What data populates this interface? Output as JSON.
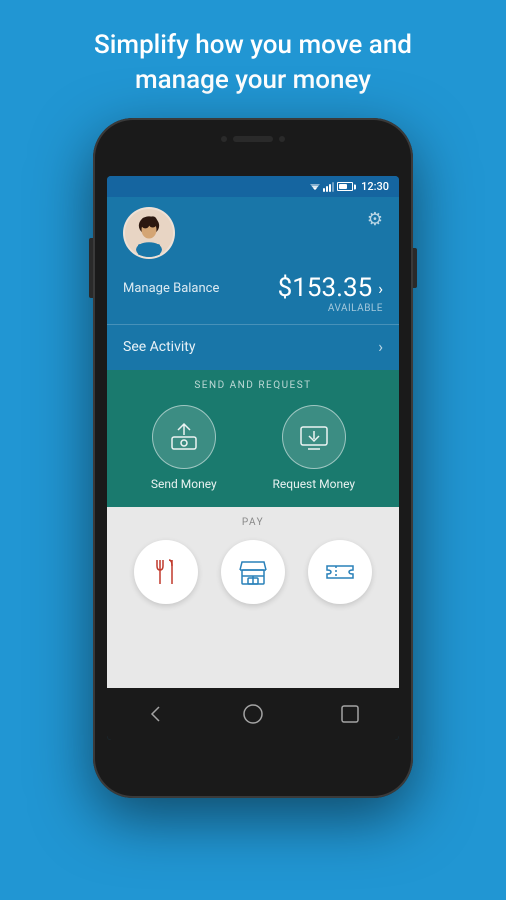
{
  "headline": {
    "line1": "Simplify how you move and",
    "line2": "manage your money"
  },
  "status_bar": {
    "time": "12:30"
  },
  "profile": {
    "manage_balance_label": "Manage Balance",
    "balance": "$153.35",
    "available_label": "AVAILABLE",
    "see_activity_label": "See Activity"
  },
  "send_request": {
    "section_title": "SEND AND REQUEST",
    "send_label": "Send Money",
    "request_label": "Request Money"
  },
  "pay": {
    "section_title": "PAY",
    "restaurant_label": "Restaurant",
    "store_label": "Store",
    "ticket_label": "Ticket"
  },
  "nav": {
    "back_label": "Back",
    "home_label": "Home",
    "recent_label": "Recent"
  }
}
